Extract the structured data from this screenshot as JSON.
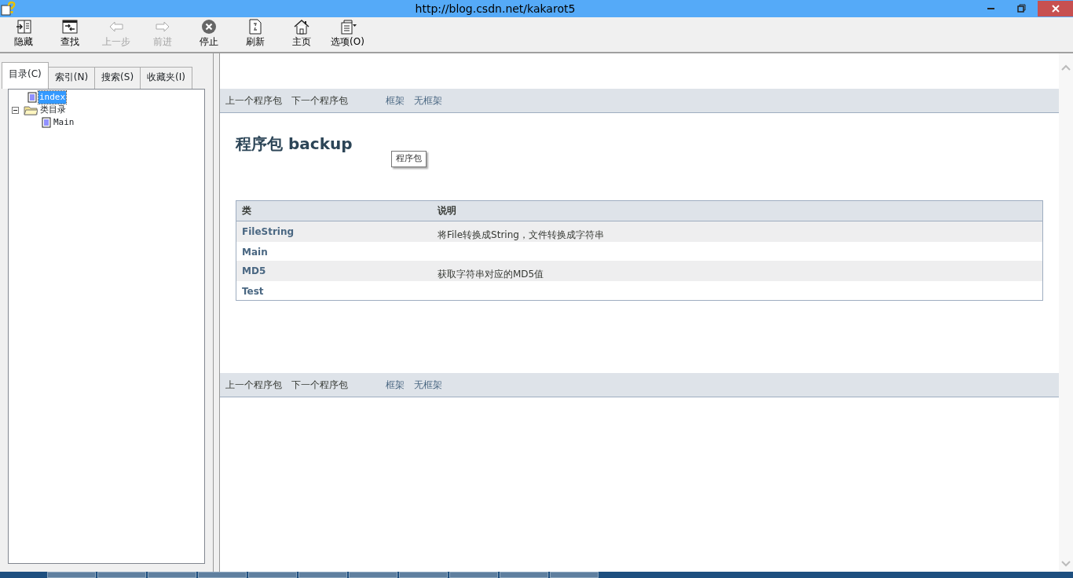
{
  "window": {
    "title": "http://blog.csdn.net/kakarot5"
  },
  "toolbar": [
    {
      "kind": "hide",
      "label": "隐藏",
      "disabled": false
    },
    {
      "kind": "find",
      "label": "查找",
      "disabled": false
    },
    {
      "kind": "back",
      "label": "上一步",
      "disabled": true
    },
    {
      "kind": "forward",
      "label": "前进",
      "disabled": true
    },
    {
      "kind": "stop",
      "label": "停止",
      "disabled": false
    },
    {
      "kind": "refresh",
      "label": "刷新",
      "disabled": false
    },
    {
      "kind": "home",
      "label": "主页",
      "disabled": false
    },
    {
      "kind": "options",
      "label": "选项(O)",
      "disabled": false
    }
  ],
  "tabs": [
    {
      "label": "目录(C)",
      "selected": true
    },
    {
      "label": "索引(N)",
      "selected": false
    },
    {
      "label": "搜索(S)",
      "selected": false
    },
    {
      "label": "收藏夹(I)",
      "selected": false
    }
  ],
  "tree": [
    {
      "kind": "page",
      "label": "index",
      "selected": true
    },
    {
      "kind": "folder",
      "label": "类目录",
      "selected": false,
      "expanded": true,
      "children": [
        {
          "kind": "page",
          "label": "Main",
          "selected": false
        }
      ]
    }
  ],
  "content": {
    "nav_top": [
      {
        "kind": "text",
        "label": "上一个程序包"
      },
      {
        "kind": "text",
        "label": "下一个程序包"
      },
      {
        "kind": "link",
        "label": "框架"
      },
      {
        "kind": "link",
        "label": "无框架"
      }
    ],
    "heading": "程序包 backup",
    "tooltip": "程序包",
    "table": {
      "columns": [
        "类",
        "说明"
      ],
      "rows": [
        {
          "name": "FileString",
          "description": "将File转换成String，文件转换成字符串"
        },
        {
          "name": "Main"
        },
        {
          "name": "MD5",
          "description": "获取字符串对应的MD5值"
        },
        {
          "name": "Test"
        }
      ]
    },
    "nav_bottom": [
      {
        "kind": "text",
        "label": "上一个程序包"
      },
      {
        "kind": "text",
        "label": "下一个程序包"
      },
      {
        "kind": "link",
        "label": "框架"
      },
      {
        "kind": "link",
        "label": "无框架"
      }
    ]
  }
}
